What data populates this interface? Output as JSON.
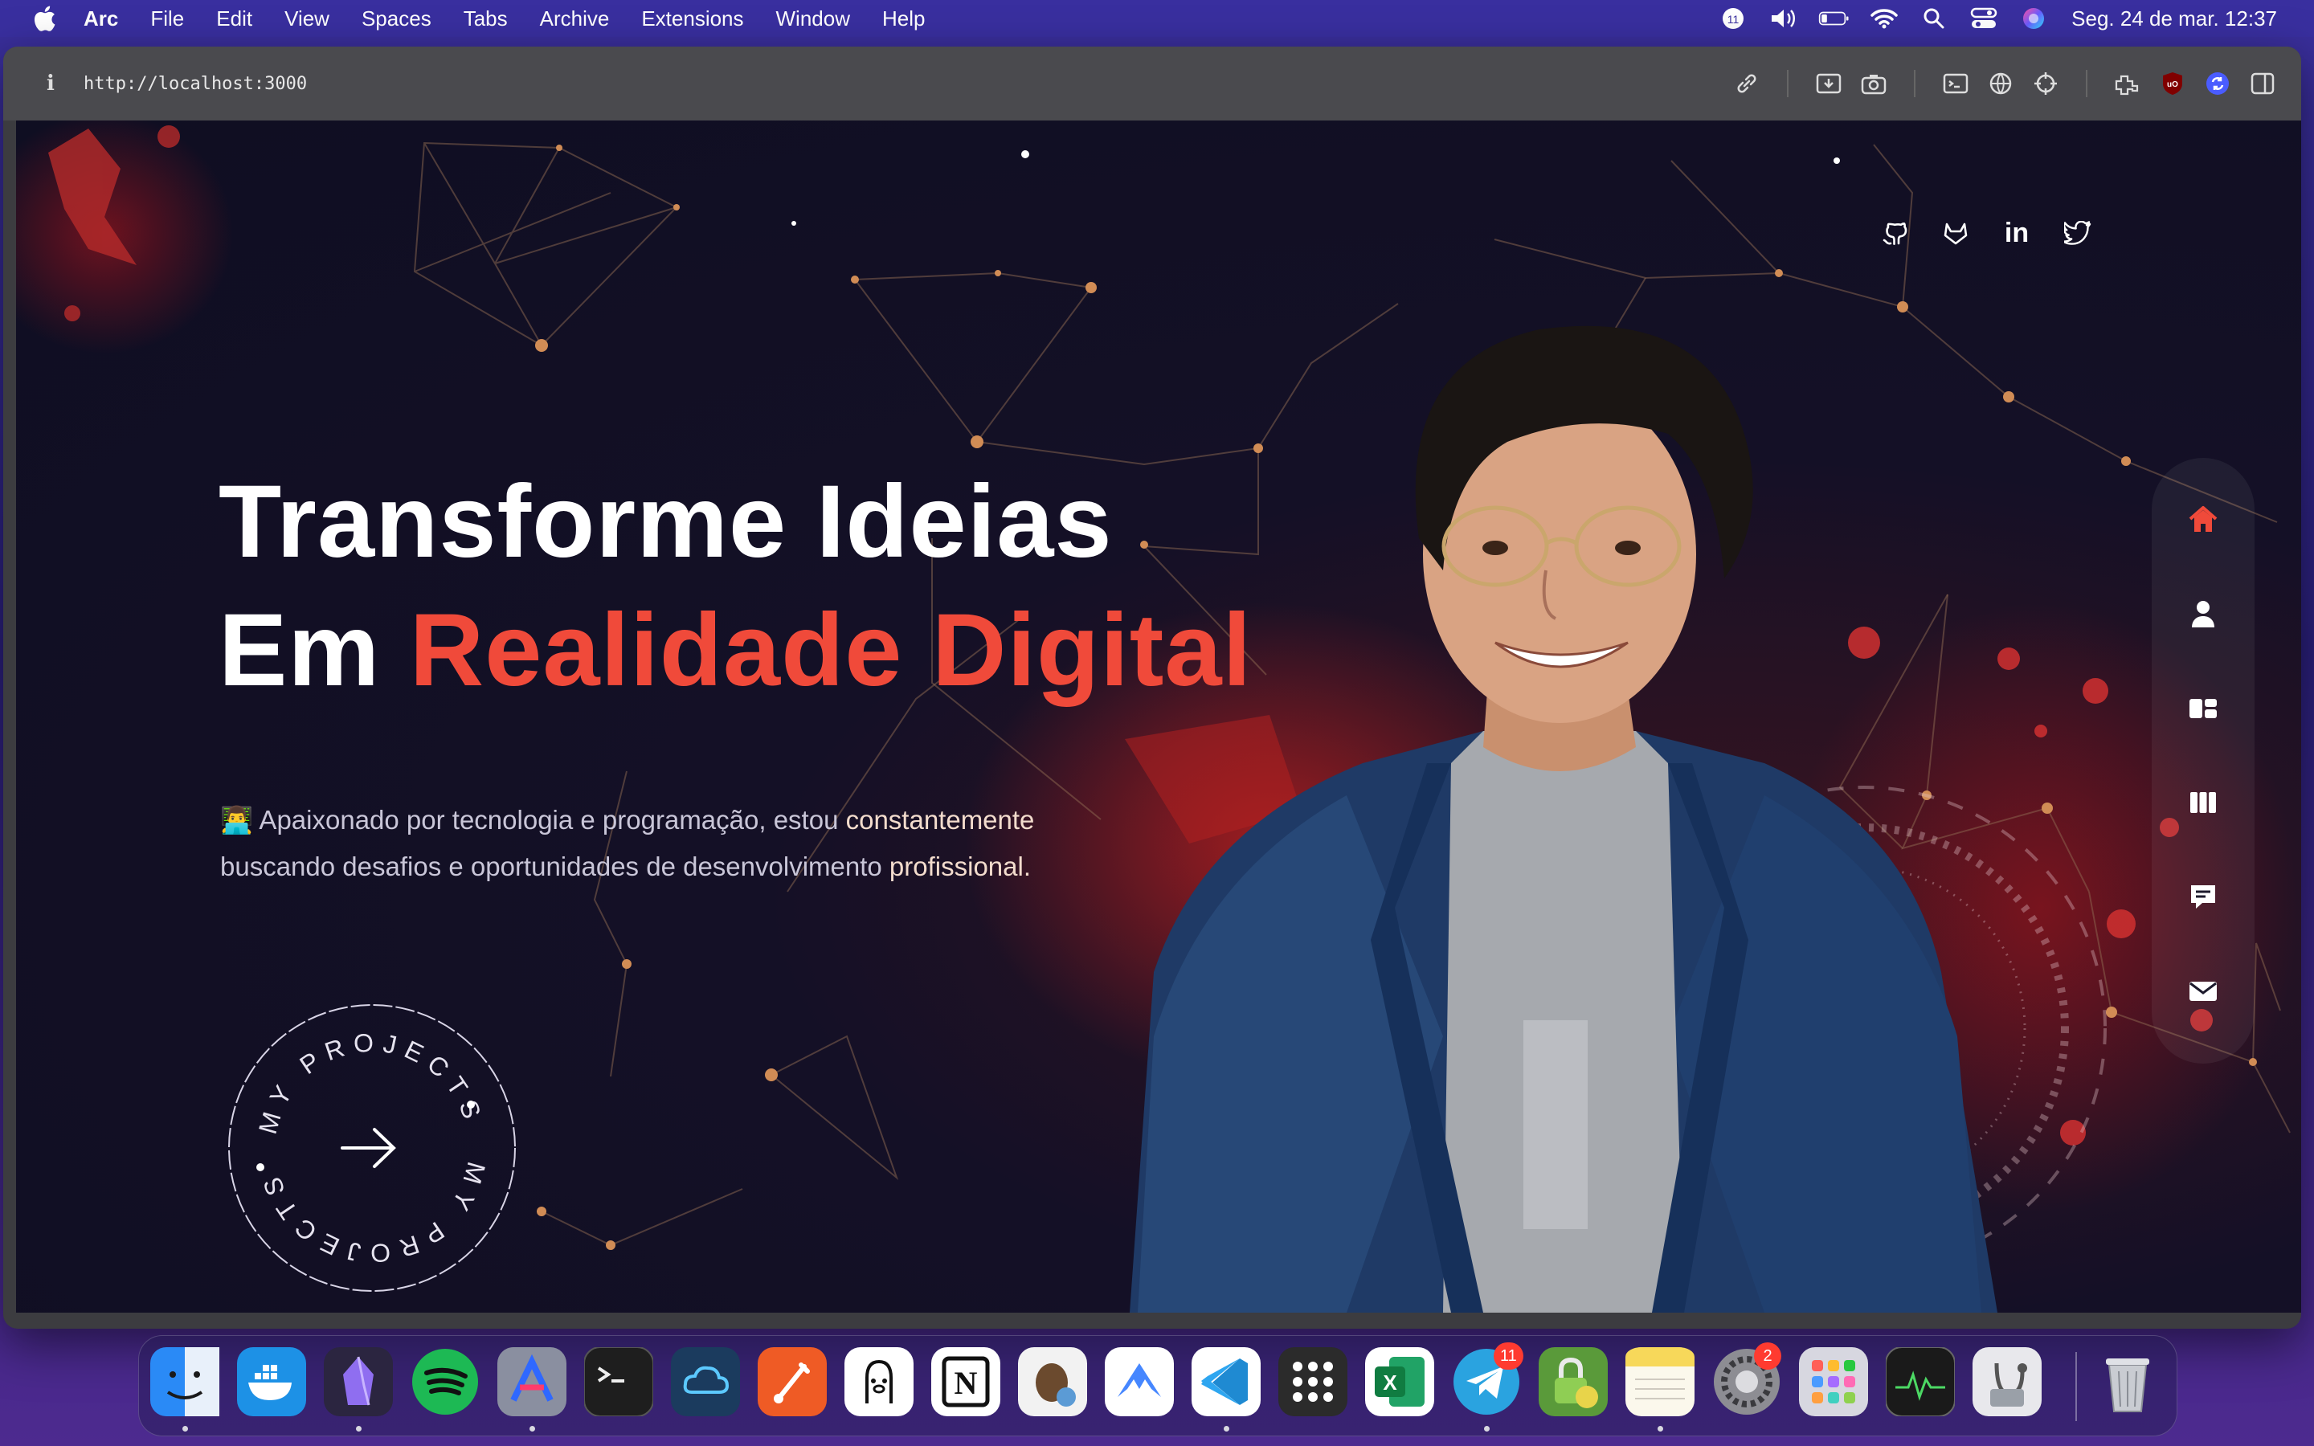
{
  "menubar": {
    "app_name": "Arc",
    "items": [
      "File",
      "Edit",
      "View",
      "Spaces",
      "Tabs",
      "Archive",
      "Extensions",
      "Window",
      "Help"
    ],
    "tray_badge": "11",
    "clock": "Seg. 24 de mar.  12:37"
  },
  "toolbar": {
    "info_glyph": "i",
    "url": "http://localhost:3000"
  },
  "hero": {
    "title_line1": "Transforme Ideias",
    "title_line2_prefix": "Em ",
    "title_line2_accent": "Realidade Digital",
    "subtitle_part1": "👨‍💻 Apaixonado por tecnologia e programação, estou ",
    "subtitle_hl1": "constantemente",
    "subtitle_part2": "buscando desafios e oportunidades de desenvolvimento ",
    "subtitle_hl2": "profissional."
  },
  "social": {
    "linkedin_label": "in"
  },
  "projects_badge": {
    "text": "MY PROJECTS"
  },
  "dock": {
    "apps": [
      {
        "name": "Finder",
        "color": "#2a8af6"
      },
      {
        "name": "Docker",
        "color": "#1d91e6"
      },
      {
        "name": "Obsidian",
        "color": "#2b2540"
      },
      {
        "name": "Spotify",
        "color": "#1db954"
      },
      {
        "name": "Instruments",
        "color": "#8a8fa0"
      },
      {
        "name": "Terminal",
        "color": "#1e1e1e"
      },
      {
        "name": "Cloud",
        "color": "#1b3b5e"
      },
      {
        "name": "Postman",
        "color": "#ef5b25"
      },
      {
        "name": "Ollama",
        "color": "#ffffff"
      },
      {
        "name": "Notion",
        "color": "#ffffff"
      },
      {
        "name": "DBeaver",
        "color": "#f2f2f2"
      },
      {
        "name": "NordVPN",
        "color": "#ffffff"
      },
      {
        "name": "VS Code",
        "color": "#ffffff"
      },
      {
        "name": "Launchpad",
        "color": "#2b2b2b"
      },
      {
        "name": "Excel",
        "color": "#1e7e45"
      },
      {
        "name": "Telegram",
        "color": "#2aa3e0"
      },
      {
        "name": "Keychain",
        "color": "#5a9a3a"
      },
      {
        "name": "Notes",
        "color": "#f7d85a"
      },
      {
        "name": "System Settings",
        "color": "#8d8d93"
      },
      {
        "name": "Apps",
        "color": "#d7d7e0"
      },
      {
        "name": "Activity Monitor",
        "color": "#1a1a1a"
      },
      {
        "name": "Disk Utility",
        "color": "#e8e8ec"
      },
      {
        "name": "Trash",
        "color": "#c9ccd2"
      }
    ],
    "badges": {
      "telegram": "11",
      "settings": "2"
    },
    "excel_label": "X",
    "notion_label": "N"
  }
}
